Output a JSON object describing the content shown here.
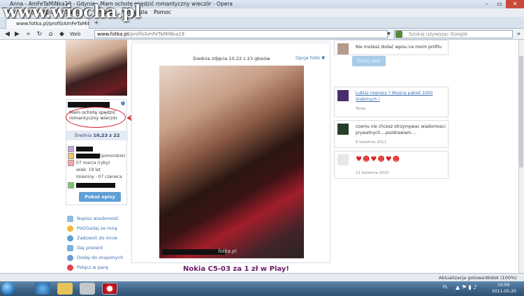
{
  "window": {
    "title": "Anna - AmFeTaMiNka19 - Gdynia - Mam ochotę spędzić romantyczny wieczór - Opera",
    "minimize": "–",
    "maximize": "▭",
    "close": "✕"
  },
  "menubar": {
    "items": [
      "Plik",
      "Edycja",
      "Widok",
      "Zakładki",
      "Widżety",
      "Narzędzia",
      "Pomoc"
    ]
  },
  "tab": {
    "label": "www.fotka.pl/profil/AmFeTaMiNka19"
  },
  "watermark": {
    "text": "www.wiocha.pl"
  },
  "address": {
    "web_label": "Web",
    "domain": "www.fotka.pl",
    "path": "/profil/AmFeTaMiNka19",
    "search_placeholder": "Szukaj używając Google"
  },
  "profile": {
    "status_message": "Mam ochotę spędzić romantyczny wieczór",
    "rating_label": "Średnia",
    "rating_value": "10,23 z 22",
    "region_suffix": "(pomorskie)",
    "birthday": "07 marca (ryby)",
    "age": "wiek: 19 lat",
    "nameday": "imieniny - 07 czerwca",
    "opisy_button": "Pokaż opisy"
  },
  "side_links": [
    "Napisz wiadomość",
    "PoGGadaj ze mną",
    "Zadzwoń do mnie",
    "Daj prezent",
    "Dodaj do znajomych",
    "Połącz w parę"
  ],
  "photo": {
    "avg_label": "Średnia zdjęcia 10,22 z 23 głosów",
    "options_label": "Opcje fotki ▼",
    "watermark": "fotka.pl",
    "headline": "Nokia C5-03 za 1 zł w Play!"
  },
  "activity": {
    "no_post": "Nie możesz dodać wpisu na moim profilu",
    "disabled_button": "Dodaj wpis",
    "items": [
      {
        "text": "Lubisz imprezy ? Wygraj pakiet 1000 Srebrnych !",
        "date": "Teraz"
      },
      {
        "text": "czemu nie chcesz otrzymywac wiadomosci prywatnych....pozdrawiam....",
        "date": "6 kwietnia 2011"
      },
      {
        "text": "",
        "date": "21 kwietnia 2010"
      }
    ]
  },
  "statusbar": {
    "left": "Aktualizacja gotowa",
    "right": "Widok (100%)"
  },
  "taskbar": {
    "lang": "PL",
    "time": "10:09",
    "date": "2011-05-20"
  },
  "colors": {
    "accent": "#3a6fb0",
    "headline": "#6a1b6a",
    "circle": "#d61e2a"
  }
}
